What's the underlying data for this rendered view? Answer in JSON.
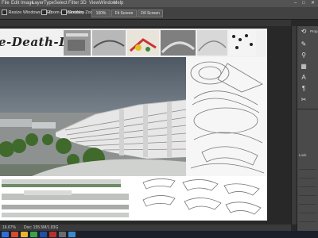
{
  "menu": {
    "items": [
      "File",
      "Edit",
      "Image",
      "Layer",
      "Type",
      "Select",
      "Filter",
      "3D",
      "View",
      "Window",
      "Help"
    ],
    "window_controls": [
      "–",
      "□",
      "✕"
    ]
  },
  "options": {
    "resize_label": "Resize Windows to Fit",
    "zoom_all_label": "Zoom All Windows",
    "scrubby_label": "Scrubby Zoom",
    "btn_100": "100%",
    "btn_fit": "Fit Screen",
    "btn_fill": "Fill Screen"
  },
  "document": {
    "title_text": "e-Death-Life"
  },
  "status": {
    "zoom": "16.67%",
    "doc_size": "Doc: 155.5M/1.83G"
  },
  "panel": {
    "items": [
      {
        "icon": "history-icon",
        "glyph": "⟲",
        "label": "Prop"
      },
      {
        "icon": "brush-icon",
        "glyph": "✎",
        "label": ""
      },
      {
        "icon": "stamp-icon",
        "glyph": "⚲",
        "label": ""
      },
      {
        "icon": "swatch-icon",
        "glyph": "▦",
        "label": ""
      },
      {
        "icon": "type-icon",
        "glyph": "A",
        "label": ""
      },
      {
        "icon": "paragraph-icon",
        "glyph": "¶",
        "label": ""
      },
      {
        "icon": "tools-icon",
        "glyph": "✂",
        "label": ""
      }
    ],
    "layers_label": "Lock",
    "lock_rows": [
      "",
      "",
      "",
      "",
      "",
      "",
      "",
      ""
    ]
  },
  "colors": {
    "app_bg": "#282828",
    "menubar": "#535353",
    "panel": "#4a4a4a",
    "green_tree": "#3f6a2c",
    "sky": "#7f8b96"
  }
}
